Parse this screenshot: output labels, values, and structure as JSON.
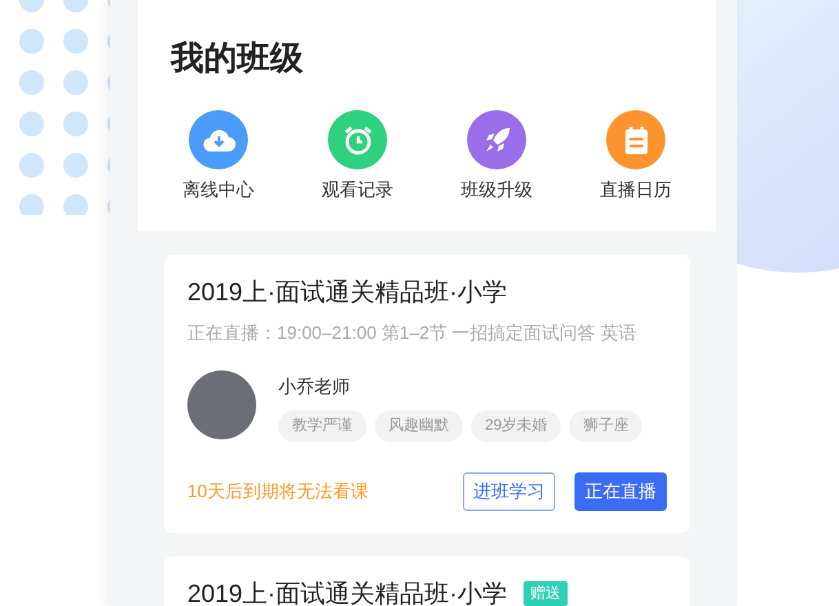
{
  "title": "我的班级",
  "shortcuts": [
    {
      "kind": "cloud",
      "label": "离线中心",
      "color": "#4a9cf8"
    },
    {
      "kind": "clock",
      "label": "观看记录",
      "color": "#2fd07f"
    },
    {
      "kind": "rocket",
      "label": "班级升级",
      "color": "#9a6ee8"
    },
    {
      "kind": "calendar",
      "label": "直播日历",
      "color": "#fd9430"
    }
  ],
  "courses": [
    {
      "title": "2019上·面试通关精品班·小学",
      "schedule": "正在直播：19:00–21:00 第1–2节 一招搞定面试问答 英语",
      "teacher": {
        "name": "小乔老师",
        "tags": [
          "教学严谨",
          "风趣幽默",
          "29岁未婚",
          "狮子座"
        ]
      },
      "warning": "10天后到期将无法看课",
      "buttons": [
        {
          "kind": "outline",
          "label": "进班学习"
        },
        {
          "kind": "primary",
          "label": "正在直播"
        }
      ]
    },
    {
      "title": "2019上·面试通关精品班·小学",
      "badge": "赠送"
    }
  ]
}
